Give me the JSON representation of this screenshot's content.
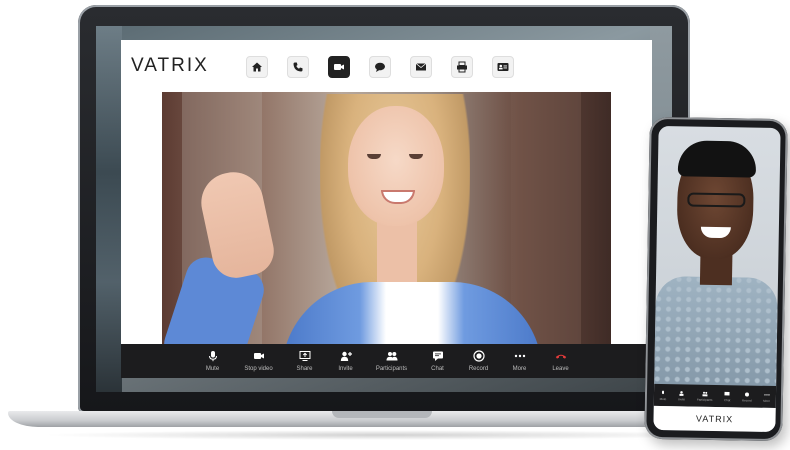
{
  "app": {
    "brand": "VATRIX"
  },
  "nav": {
    "items": [
      {
        "icon": "home-icon",
        "active": false
      },
      {
        "icon": "phone-icon",
        "active": false
      },
      {
        "icon": "video-camera-icon",
        "active": true
      },
      {
        "icon": "chat-bubble-icon",
        "active": false
      },
      {
        "icon": "mail-icon",
        "active": false
      },
      {
        "icon": "fax-icon",
        "active": false
      },
      {
        "icon": "contact-card-icon",
        "active": false
      }
    ]
  },
  "toolbar": {
    "items": [
      {
        "label": "Mute",
        "icon": "microphone-icon"
      },
      {
        "label": "Stop video",
        "icon": "video-camera-icon"
      },
      {
        "label": "Share",
        "icon": "share-screen-icon"
      },
      {
        "label": "Invite",
        "icon": "add-user-icon"
      },
      {
        "label": "Participants",
        "icon": "participants-icon"
      },
      {
        "label": "Chat",
        "icon": "chat-icon"
      },
      {
        "label": "Record",
        "icon": "record-icon"
      },
      {
        "label": "More",
        "icon": "more-icon"
      },
      {
        "label": "Leave",
        "icon": "hang-up-icon"
      }
    ]
  },
  "phone": {
    "toolbar": [
      {
        "label": "Mute",
        "icon": "microphone-icon"
      },
      {
        "label": "Invite",
        "icon": "add-user-icon"
      },
      {
        "label": "Participants",
        "icon": "participants-icon"
      },
      {
        "label": "Chat",
        "icon": "chat-icon"
      },
      {
        "label": "Record",
        "icon": "record-icon"
      },
      {
        "label": "More",
        "icon": "more-icon"
      }
    ],
    "brand": "VATRIX"
  },
  "colors": {
    "toolbar_bg": "#1c1c1e",
    "leave_red": "#e03a3a",
    "nav_active": "#222222"
  }
}
